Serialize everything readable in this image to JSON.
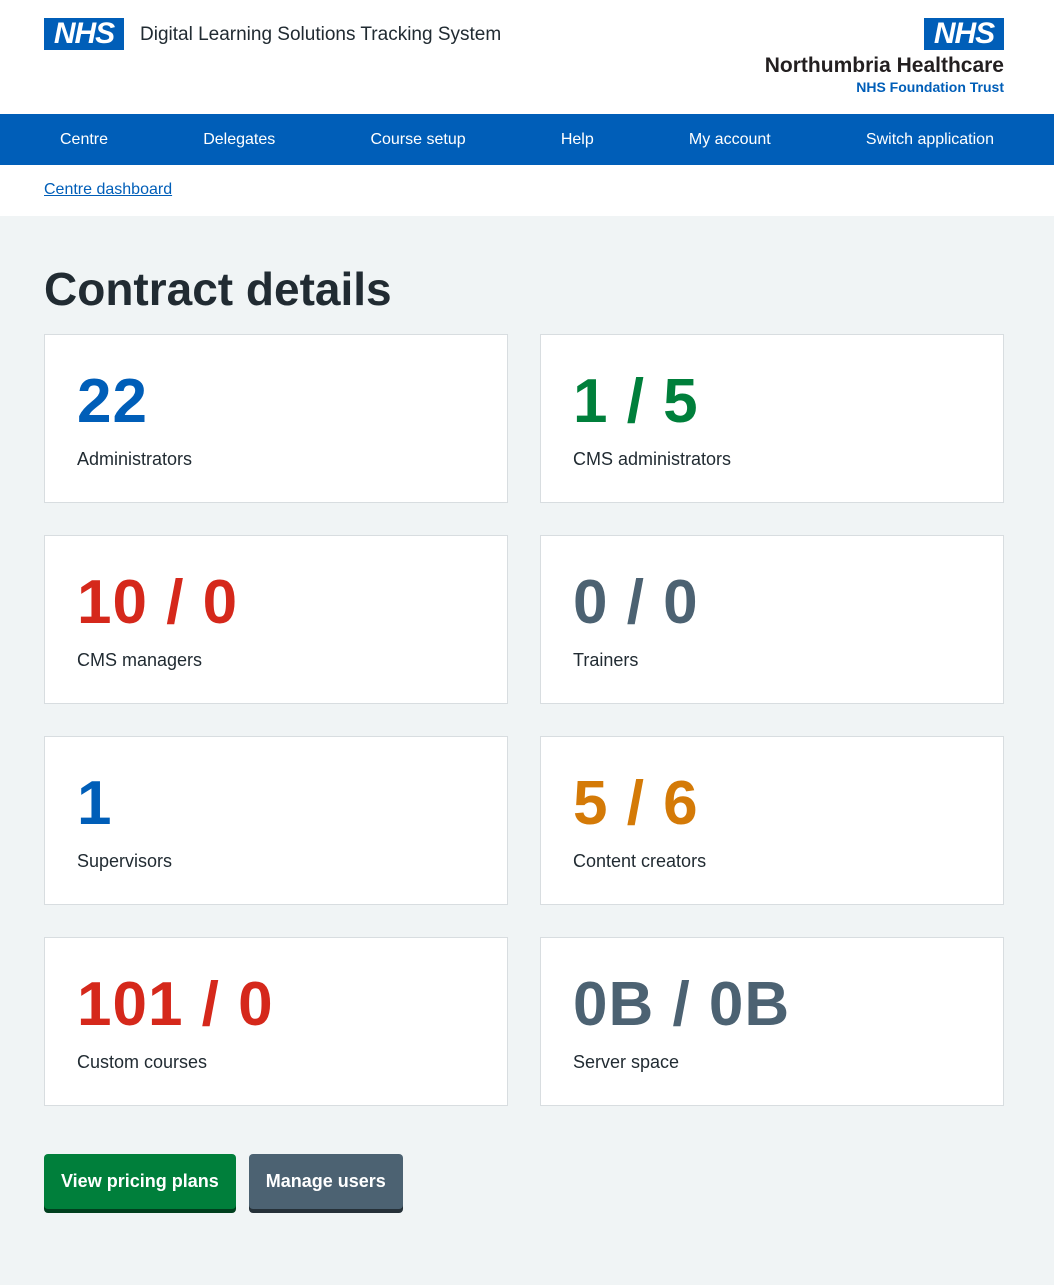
{
  "header": {
    "logo_left": "NHS",
    "app_title": "Digital Learning Solutions Tracking System",
    "logo_right": "NHS",
    "org_name": "Northumbria Healthcare",
    "org_sub": "NHS Foundation Trust"
  },
  "nav": {
    "items": [
      "Centre",
      "Delegates",
      "Course setup",
      "Help",
      "My account",
      "Switch application"
    ]
  },
  "breadcrumb": {
    "label": "Centre dashboard"
  },
  "page": {
    "title": "Contract details"
  },
  "cards": [
    {
      "value": "22",
      "label": "Administrators",
      "color": "#005eb8"
    },
    {
      "value": "1 / 5",
      "label": "CMS administrators",
      "color": "#007f3b"
    },
    {
      "value": "10 / 0",
      "label": "CMS managers",
      "color": "#d5281b"
    },
    {
      "value": "0 / 0",
      "label": "Trainers",
      "color": "#4c6272"
    },
    {
      "value": "1",
      "label": "Supervisors",
      "color": "#005eb8"
    },
    {
      "value": "5 / 6",
      "label": "Content creators",
      "color": "#d47a07"
    },
    {
      "value": "101 / 0",
      "label": "Custom courses",
      "color": "#d5281b"
    },
    {
      "value": "0B / 0B",
      "label": "Server space",
      "color": "#4c6272"
    }
  ],
  "actions": {
    "pricing_label": "View pricing plans",
    "manage_label": "Manage users"
  }
}
